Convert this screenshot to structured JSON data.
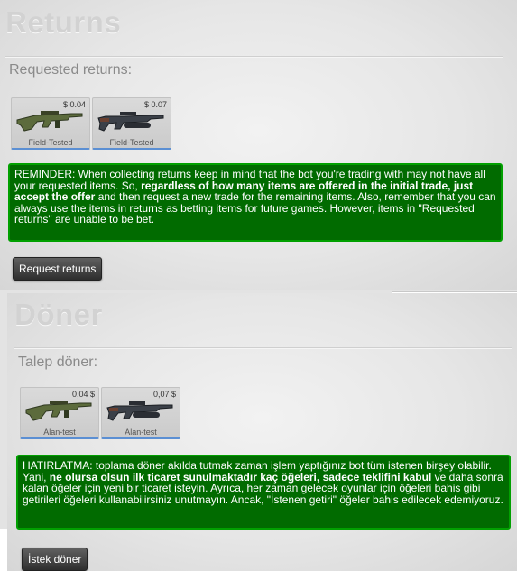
{
  "english": {
    "heading": "Returns",
    "requested_label": "Requested returns:",
    "items": [
      {
        "price": "$ 0.04",
        "wear": "Field-Tested",
        "icon": "rifle-famas-icon"
      },
      {
        "price": "$ 0.07",
        "wear": "Field-Tested",
        "icon": "smg-bizon-icon"
      }
    ],
    "reminder_1": "REMINDER: When collecting returns keep in mind that the bot you're trading with may not have all your requested items. So, ",
    "reminder_bold": "regardless of how many items are offered in the initial trade, just accept the offer",
    "reminder_2": " and then request a new trade for the remaining items. Also, remember that you can always use the items in returns as betting items for future games. However, items in \"Requested returns\" are unable to be bet.",
    "button": "Request returns"
  },
  "turkish": {
    "heading": "Döner",
    "requested_label": "Talep döner:",
    "items": [
      {
        "price": "0,04 $",
        "wear": "Alan-test",
        "icon": "rifle-famas-icon"
      },
      {
        "price": "0,07 $",
        "wear": "Alan-test",
        "icon": "smg-bizon-icon"
      }
    ],
    "reminder_1": "HATIRLATMA: toplama döner akılda tutmak zaman işlem yaptığınız bot tüm istenen birşey olabilir. Yani, ",
    "reminder_bold": "ne olursa olsun ilk ticaret sunulmaktadır kaç öğeleri, sadece teklifini kabul",
    "reminder_2": " ve daha sonra kalan öğeler için yeni bir ticaret isteyin. Ayrıca, her zaman gelecek oyunlar için öğeleri bahis gibi getirileri öğeleri kullanabilirsiniz unutmayın. Ancak, \"İstenen getiri\" öğeler bahis edilecek edemiyoruz.",
    "button": "İstek döner"
  },
  "colors": {
    "notice_bg": "#016b00",
    "notice_border": "#01a000",
    "item_underline": "#5b8fd3"
  }
}
